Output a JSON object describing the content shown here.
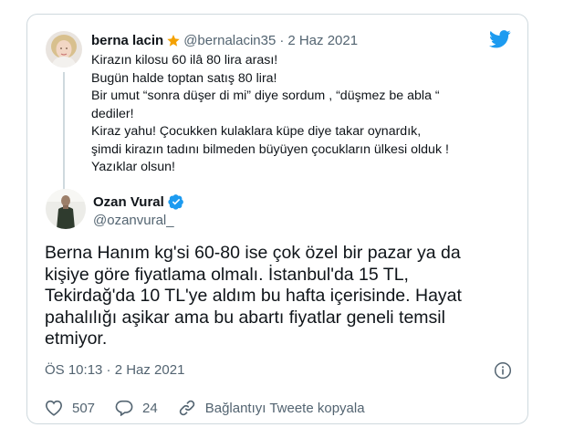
{
  "quoted": {
    "name": "berna lacin",
    "handle": "@bernalacin35",
    "separator": "·",
    "date": "2 Haz 2021",
    "lines": [
      "Kirazın kilosu 60 ilâ 80 lira arası!",
      "Bugün halde toptan satış 80 lira!",
      "Bir umut “sonra düşer di mi” diye sordum , “düşmez be abla “",
      "dediler!",
      "Kiraz yahu! Çocukken kulaklara küpe diye takar oynardık,",
      "şimdi kirazın tadını bilmeden büyüyen çocukların ülkesi olduk !",
      "Yazıklar olsun!"
    ]
  },
  "main": {
    "name": "Ozan Vural",
    "handle": "@ozanvural_",
    "lines": [
      "Berna Hanım kg'si 60-80 ise çok özel bir pazar ya da",
      "kişiye göre fiyatlama olmalı. İstanbul'da 15 TL,",
      "Tekirdağ'da 10 TL'ye aldım bu hafta içerisinde. Hayat",
      "pahalılığı aşikar ama bu abartı fiyatlar geneli temsil",
      "etmiyor."
    ],
    "timestamp": "ÖS 10:13 · 2 Haz 2021"
  },
  "actions": {
    "likes": "507",
    "replies": "24",
    "copy_link": "Bağlantıyı Tweete kopyala"
  },
  "colors": {
    "twitter_blue": "#1d9bf0",
    "muted": "#536471",
    "border": "#cfd9de",
    "badge_orange": "#f4a100"
  }
}
